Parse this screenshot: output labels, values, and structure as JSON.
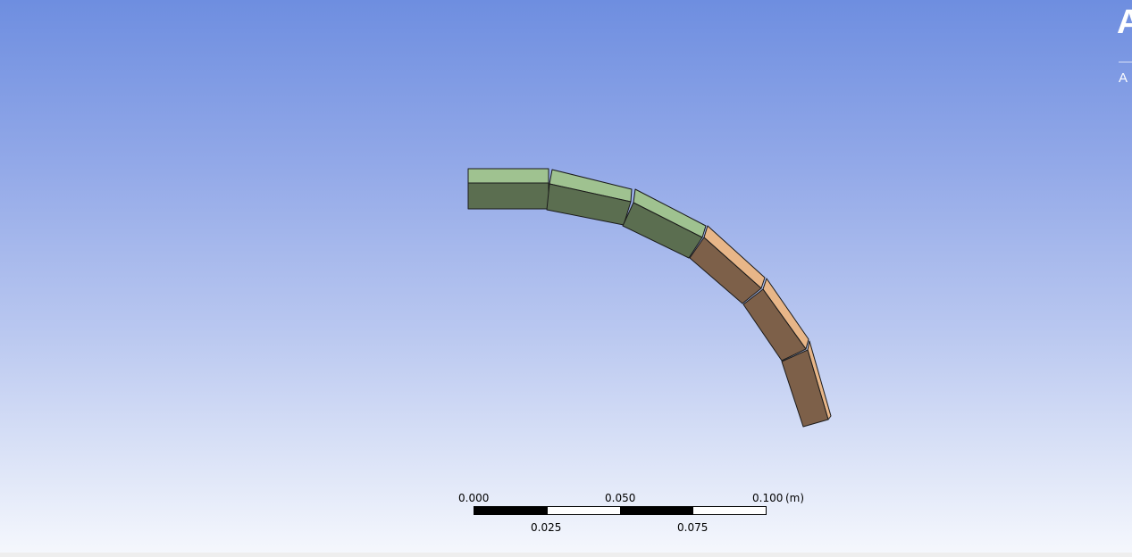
{
  "branding": {
    "logo_letter": "A",
    "subtitle": "A"
  },
  "scale": {
    "top_labels": [
      "0.000",
      "0.050",
      "0.100"
    ],
    "unit": "(m)",
    "bottom_labels": [
      "0.025",
      "0.075"
    ]
  },
  "colors": {
    "green_front": "#5b6e50",
    "green_top": "#9fc290",
    "orange_front": "#7d6049",
    "orange_top": "#e8b688",
    "edge": "#1a1a1a"
  }
}
